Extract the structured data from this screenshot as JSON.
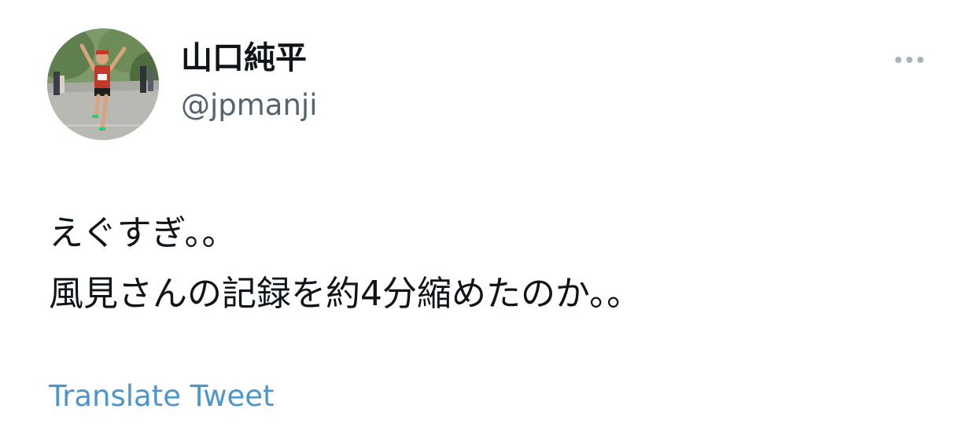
{
  "author": {
    "display_name": "山口純平",
    "handle": "@jpmanji",
    "avatar_icon": "runner-photo-avatar"
  },
  "more_icon": "more-horizontal-icon",
  "tweet": {
    "lines": [
      "えぐすぎ。。",
      "風見さんの記録を約4分縮めたのか。。"
    ],
    "translate_label": "Translate Tweet"
  },
  "colors": {
    "text": "#0f1419",
    "secondary_text": "#536471",
    "link": "#4b97cc",
    "more_dots": "#aab4bd"
  }
}
